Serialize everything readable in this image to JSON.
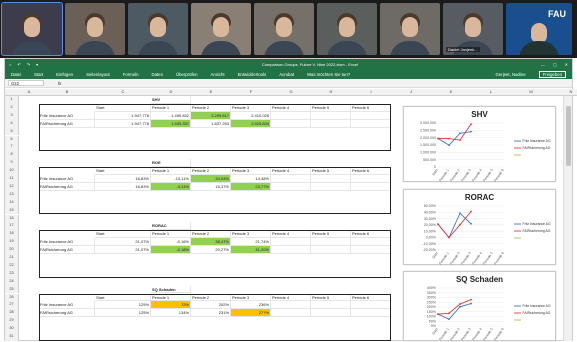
{
  "video": {
    "tiles": [
      {
        "w": 60,
        "bg": "#3c3c4c",
        "name": ""
      },
      {
        "w": 60,
        "bg": "#6b6058",
        "name": ""
      },
      {
        "w": 60,
        "bg": "#4d5a63",
        "name": ""
      },
      {
        "w": 60,
        "bg": "#8a7f74",
        "name": ""
      },
      {
        "w": 60,
        "bg": "#75706a",
        "name": ""
      },
      {
        "w": 60,
        "bg": "#5a5f5e",
        "name": ""
      },
      {
        "w": 60,
        "bg": "#6e6a66",
        "name": ""
      },
      {
        "w": 60,
        "bg": "#575c62",
        "name": "Daniel Janjenk..."
      },
      {
        "w": 66,
        "bg": "#1a4f8f",
        "name": ""
      }
    ],
    "fau": "FAU"
  },
  "excel": {
    "title": "Comparison Groups. Future V. Nine 2022.xlsm - Excel",
    "quick_access": [
      "⌂",
      "↶",
      "↷",
      "▾"
    ],
    "window_controls": [
      "—",
      "▢",
      "✕"
    ],
    "menu": [
      "Datei",
      "Start",
      "Einfügen",
      "Seitenlayout",
      "Formeln",
      "Daten",
      "Überprüfen",
      "Ansicht",
      "Entwicklertools",
      "Acrobat",
      "Was möchten Sie tun?"
    ],
    "user": "Gerjeet, Nadine",
    "share": "Freigeben",
    "namebox": "G22",
    "fx": "fx"
  },
  "columns": [
    "A",
    "B",
    "C",
    "D",
    "E",
    "F",
    "G",
    "H",
    "I",
    "J",
    "K",
    "L",
    "M",
    "N"
  ],
  "rows": [
    "1",
    "2",
    "3",
    "4",
    "5",
    "6",
    "7",
    "8",
    "9",
    "10",
    "11",
    "12",
    "13",
    "14",
    "15",
    "16",
    "17",
    "18",
    "19",
    "20",
    "21",
    "22",
    "23",
    "24",
    "25",
    "26",
    "27",
    "28",
    "29",
    "30",
    "31"
  ],
  "tables": [
    {
      "title": "SHV",
      "top_row": 1,
      "header": [
        "Start",
        "Periode 1",
        "Periode 2",
        "Periode 3",
        "Periode 4",
        "Periode 5",
        "Periode 6"
      ],
      "rows": [
        {
          "name": "Fritz Insurance AG",
          "vals": [
            "1.947.778",
            "1.490.832",
            "2.299.617",
            "2.410.028",
            "",
            "",
            ""
          ],
          "hl": [
            0,
            0,
            1,
            0,
            0,
            0,
            0
          ]
        },
        {
          "name": "FAIRsicherung AG",
          "vals": [
            "1.947.778",
            "1.935.337",
            "1.837.253",
            "2.925.834",
            "",
            "",
            ""
          ],
          "hl": [
            0,
            1,
            0,
            1,
            0,
            0,
            0
          ]
        }
      ]
    },
    {
      "title": "ROE",
      "top_row": 9,
      "header": [
        "Start",
        "Periode 1",
        "Periode 2",
        "Periode 3",
        "Periode 4",
        "Periode 5",
        "Periode 6"
      ],
      "rows": [
        {
          "name": "Fritz Insurance AG",
          "vals": [
            "16,83%",
            "-10,11%",
            "34,04%",
            "14,48%",
            "",
            "",
            ""
          ],
          "hl": [
            0,
            0,
            1,
            0,
            0,
            0,
            0
          ]
        },
        {
          "name": "FAIRsicherung AG",
          "vals": [
            "16,83%",
            "-0,11%",
            "15,37%",
            "23,77%",
            "",
            "",
            ""
          ],
          "hl": [
            0,
            1,
            0,
            1,
            0,
            0,
            0
          ]
        }
      ]
    },
    {
      "title": "RORAC",
      "top_row": 17,
      "header": [
        "Start",
        "Periode 1",
        "Periode 2",
        "Periode 3",
        "Periode 4",
        "Periode 5",
        "Periode 6"
      ],
      "rows": [
        {
          "name": "Fritz Insurance AG",
          "vals": [
            "21,07%",
            "-0,16%",
            "38,47%",
            "21,74%",
            "",
            "",
            ""
          ],
          "hl": [
            0,
            0,
            1,
            0,
            0,
            0,
            0
          ]
        },
        {
          "name": "FAIRsicherung AG",
          "vals": [
            "21,07%",
            "-0,18%",
            "20,27%",
            "41,20%",
            "",
            "",
            ""
          ],
          "hl": [
            0,
            1,
            0,
            1,
            0,
            0,
            0
          ]
        }
      ]
    },
    {
      "title": "SQ Schaden",
      "top_row": 25,
      "header": [
        "Start",
        "Periode 1",
        "Periode 2",
        "Periode 3",
        "Periode 4",
        "Periode 5",
        "Periode 6"
      ],
      "rows": [
        {
          "name": "Fritz Insurance AG",
          "vals": [
            "125%",
            "72%",
            "202%",
            "236%",
            "",
            "",
            ""
          ],
          "hl": [
            0,
            2,
            0,
            0,
            0,
            0,
            0
          ]
        },
        {
          "name": "FAIRsicherung AG",
          "vals": [
            "125%",
            "134%",
            "231%",
            "277%",
            "",
            "",
            ""
          ],
          "hl": [
            0,
            0,
            0,
            2,
            0,
            0,
            0
          ]
        }
      ]
    }
  ],
  "colors": {
    "green": "#92d050",
    "orange": "#ffc000",
    "excel": "#217346",
    "s1": "#4472c4",
    "s2": "#e03b3b",
    "s3": "#a5c45a"
  },
  "chart_data": [
    {
      "type": "line",
      "title": "SHV",
      "categories": [
        "Start",
        "Periode 1",
        "Periode 2",
        "Periode 3",
        "Periode 4",
        "Periode 5",
        "Periode 6"
      ],
      "ylim": [
        0,
        3000000
      ],
      "yticks": [
        "3.000.000",
        "2.500.000",
        "2.000.000",
        "1.500.000",
        "1.000.000",
        "500.000",
        "0"
      ],
      "series": [
        {
          "name": "Fritz Insurance AG",
          "values": [
            1947778,
            1490832,
            2299617,
            2410028,
            null,
            null,
            null
          ]
        },
        {
          "name": "FAIRsicherung AG",
          "values": [
            1947778,
            1935337,
            1837253,
            2925834,
            null,
            null,
            null
          ]
        }
      ]
    },
    {
      "type": "line",
      "title": "RORAC",
      "categories": [
        "Start",
        "Periode 1",
        "Periode 2",
        "Periode 3",
        "Periode 4",
        "Periode 5",
        "Periode 6"
      ],
      "ylim": [
        -0.2,
        0.5
      ],
      "yticks": [
        "50,00%",
        "40,00%",
        "30,00%",
        "20,00%",
        "10,00%",
        "0,00%",
        "-10,00%",
        "-20,00%"
      ],
      "series": [
        {
          "name": "Fritz Insurance AG",
          "values": [
            0.2107,
            -0.0016,
            0.3847,
            0.2174,
            null,
            null,
            null
          ]
        },
        {
          "name": "FAIRsicherung AG",
          "values": [
            0.2107,
            -0.0018,
            0.2027,
            0.412,
            null,
            null,
            null
          ]
        }
      ]
    },
    {
      "type": "line",
      "title": "SQ Schaden",
      "categories": [
        "Start",
        "Periode 1",
        "Periode 2",
        "Periode 3",
        "Periode 4",
        "Periode 5",
        "Periode 6"
      ],
      "ylim": [
        0,
        4
      ],
      "yticks": [
        "400%",
        "350%",
        "300%",
        "250%",
        "200%",
        "150%",
        "100%",
        "50%",
        "0%"
      ],
      "series": [
        {
          "name": "Fritz Insurance AG",
          "values": [
            1.25,
            0.72,
            2.02,
            2.36,
            null,
            null,
            null
          ]
        },
        {
          "name": "FAIRsicherung AG",
          "values": [
            1.25,
            1.34,
            2.31,
            2.77,
            null,
            null,
            null
          ]
        }
      ]
    }
  ]
}
